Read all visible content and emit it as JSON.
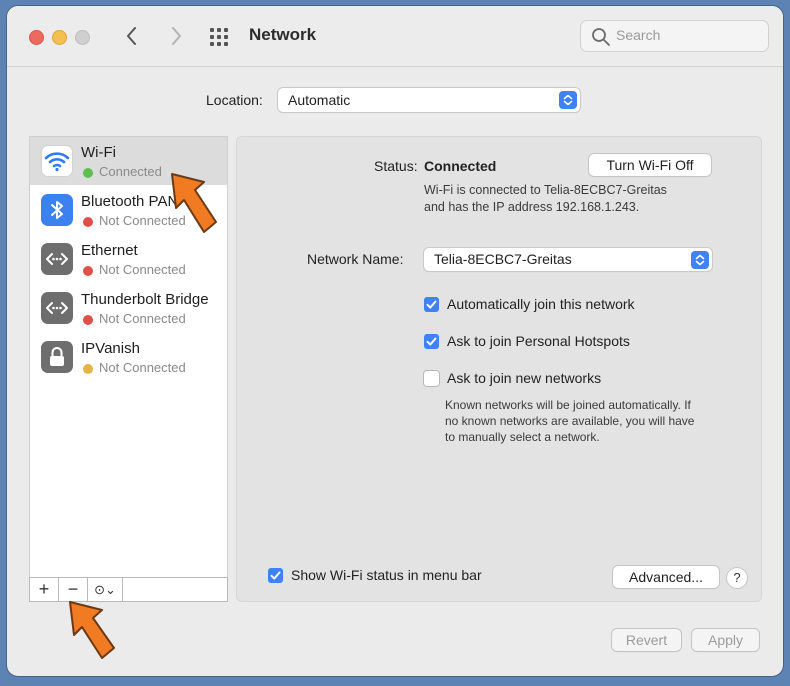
{
  "window": {
    "title": "Network",
    "search_placeholder": "Search"
  },
  "location": {
    "label": "Location:",
    "value": "Automatic"
  },
  "services": [
    {
      "name": "Wi-Fi",
      "status": "Connected",
      "status_color": "#5fbf4e",
      "icon": "wifi-icon",
      "selected": true
    },
    {
      "name": "Bluetooth PAN",
      "status": "Not Connected",
      "status_color": "#e0504a",
      "icon": "bluetooth-icon",
      "selected": false
    },
    {
      "name": "Ethernet",
      "status": "Not Connected",
      "status_color": "#e0504a",
      "icon": "ethernet-icon",
      "selected": false
    },
    {
      "name": "Thunderbolt Bridge",
      "status": "Not Connected",
      "status_color": "#e0504a",
      "icon": "thunderbolt-icon",
      "selected": false
    },
    {
      "name": "IPVanish",
      "status": "Not Connected",
      "status_color": "#e6b443",
      "icon": "lock-icon",
      "selected": false
    }
  ],
  "sidebar_tools": {
    "add": "+",
    "remove": "−",
    "action": "⊙⌄"
  },
  "detail": {
    "status_label": "Status:",
    "status_value": "Connected",
    "turn_off_button": "Turn Wi-Fi Off",
    "status_desc_1": "Wi-Fi is connected to Telia-8ECBC7-Greitas",
    "status_desc_2": "and has the IP address 192.168.1.243.",
    "network_name_label": "Network Name:",
    "network_name_value": "Telia-8ECBC7-Greitas",
    "auto_join": {
      "label": "Automatically join this network",
      "checked": true
    },
    "ask_hotspots": {
      "label": "Ask to join Personal Hotspots",
      "checked": true
    },
    "ask_new": {
      "label": "Ask to join new networks",
      "checked": false
    },
    "known_note_1": "Known networks will be joined automatically. If",
    "known_note_2": "no known networks are available, you will have",
    "known_note_3": "to manually select a network.",
    "show_status": {
      "label": "Show Wi-Fi status in menu bar",
      "checked": true
    },
    "advanced_button": "Advanced...",
    "help_button": "?"
  },
  "footer": {
    "revert_button": "Revert",
    "apply_button": "Apply"
  },
  "colors": {
    "accent": "#3f82f6",
    "annotation_arrow": "#f07b22"
  }
}
